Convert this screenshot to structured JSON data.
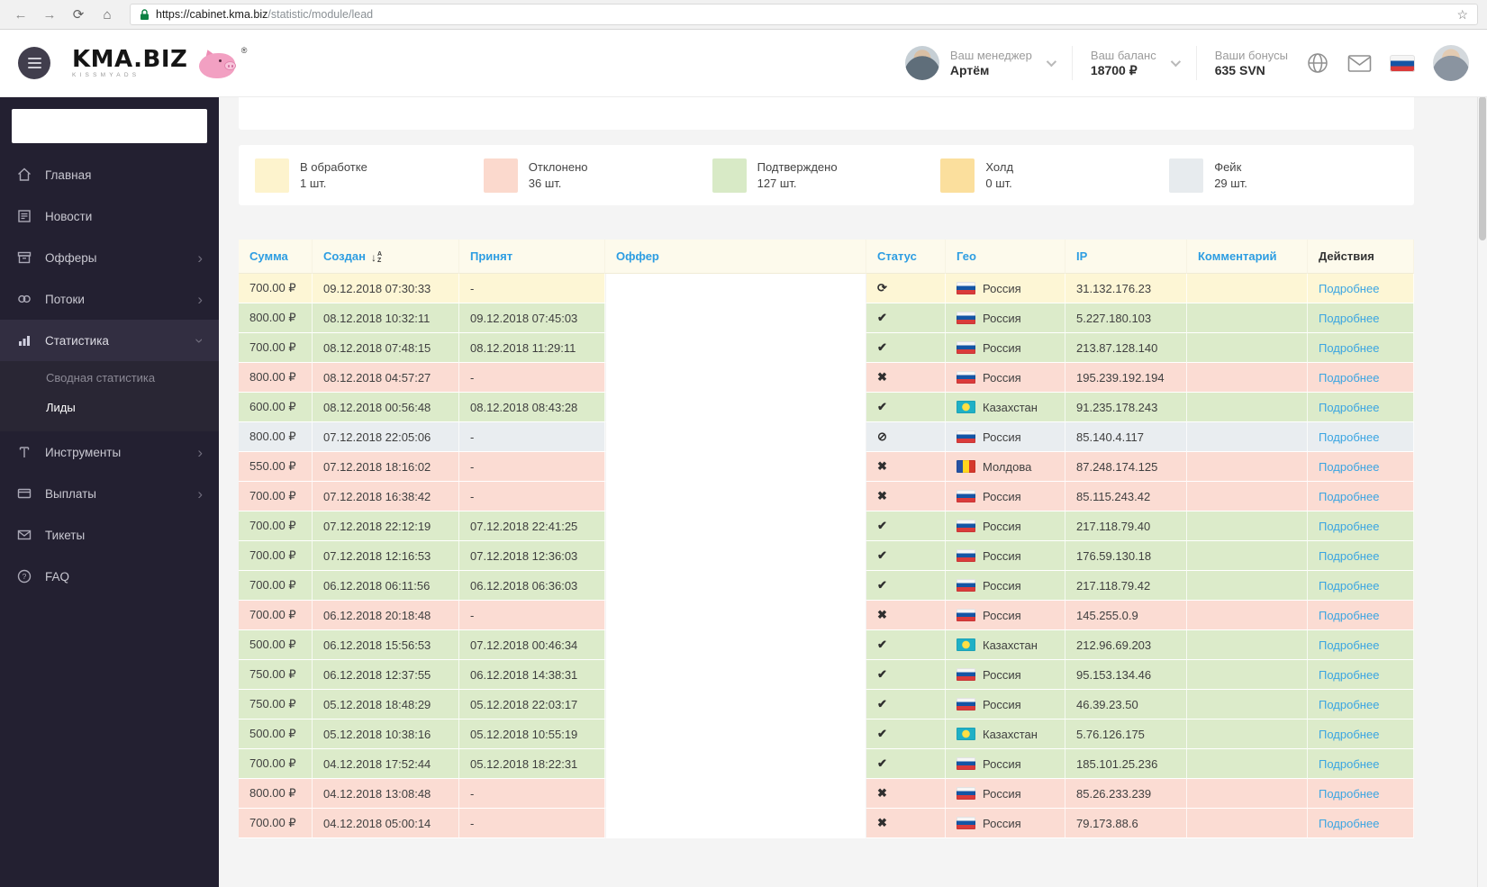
{
  "browser": {
    "url_host": "https://cabinet.kma.biz",
    "url_path": "/statistic/module/lead"
  },
  "header": {
    "logo_text": "KMA.BIZ",
    "logo_sub": "KISSMYADS",
    "reg_mark": "®",
    "manager_label": "Ваш менеджер",
    "manager_name": "Артём",
    "balance_label": "Ваш баланс",
    "balance_value": "18700 ₽",
    "bonus_label": "Ваши бонусы",
    "bonus_value": "635 SVN"
  },
  "sidebar": {
    "search_value": "",
    "items": [
      {
        "label": "Главная",
        "icon": "home-icon"
      },
      {
        "label": "Новости",
        "icon": "news-icon"
      },
      {
        "label": "Офферы",
        "icon": "offers-icon",
        "chevron": "right"
      },
      {
        "label": "Потоки",
        "icon": "streams-icon",
        "chevron": "right"
      },
      {
        "label": "Статистика",
        "icon": "stats-icon",
        "chevron": "down",
        "active": true,
        "submenu": [
          {
            "label": "Сводная статистика",
            "active": false
          },
          {
            "label": "Лиды",
            "active": true
          }
        ]
      },
      {
        "label": "Инструменты",
        "icon": "tools-icon",
        "chevron": "right"
      },
      {
        "label": "Выплаты",
        "icon": "payments-icon",
        "chevron": "right"
      },
      {
        "label": "Тикеты",
        "icon": "tickets-icon"
      },
      {
        "label": "FAQ",
        "icon": "faq-icon"
      }
    ]
  },
  "legend": [
    {
      "label": "В обработке",
      "count": "1 шт.",
      "color": "#fdf3cd"
    },
    {
      "label": "Отклонено",
      "count": "36 шт.",
      "color": "#fbd9cd"
    },
    {
      "label": "Подтверждено",
      "count": "127 шт.",
      "color": "#d8eac6"
    },
    {
      "label": "Холд",
      "count": "0 шт.",
      "color": "#fbdf9d"
    },
    {
      "label": "Фейк",
      "count": "29 шт.",
      "color": "#e7ebee"
    }
  ],
  "table": {
    "headers": [
      {
        "label": "Сумма",
        "link": true
      },
      {
        "label": "Создан",
        "link": true,
        "sort_icon": true
      },
      {
        "label": "Принят",
        "link": true
      },
      {
        "label": "Оффер",
        "link": true
      },
      {
        "label": "Статус",
        "link": true
      },
      {
        "label": "Гео",
        "link": true
      },
      {
        "label": "IP",
        "link": true
      },
      {
        "label": "Комментарий",
        "link": true
      },
      {
        "label": "Действия",
        "link": false
      }
    ],
    "action_label": "Подробнее",
    "rows": [
      {
        "sum": "700.00 ₽",
        "created": "09.12.2018 07:30:33",
        "accepted": "-",
        "status": "processing",
        "country": "Россия",
        "flag": "ru",
        "ip": "31.132.176.23",
        "comment": ""
      },
      {
        "sum": "800.00 ₽",
        "created": "08.12.2018 10:32:11",
        "accepted": "09.12.2018 07:45:03",
        "status": "approved",
        "country": "Россия",
        "flag": "ru",
        "ip": "5.227.180.103",
        "comment": ""
      },
      {
        "sum": "700.00 ₽",
        "created": "08.12.2018 07:48:15",
        "accepted": "08.12.2018 11:29:11",
        "status": "approved",
        "country": "Россия",
        "flag": "ru",
        "ip": "213.87.128.140",
        "comment": ""
      },
      {
        "sum": "800.00 ₽",
        "created": "08.12.2018 04:57:27",
        "accepted": "-",
        "status": "rejected",
        "country": "Россия",
        "flag": "ru",
        "ip": "195.239.192.194",
        "comment": ""
      },
      {
        "sum": "600.00 ₽",
        "created": "08.12.2018 00:56:48",
        "accepted": "08.12.2018 08:43:28",
        "status": "approved",
        "country": "Казахстан",
        "flag": "kz",
        "ip": "91.235.178.243",
        "comment": ""
      },
      {
        "sum": "800.00 ₽",
        "created": "07.12.2018 22:05:06",
        "accepted": "-",
        "status": "fake",
        "country": "Россия",
        "flag": "ru",
        "ip": "85.140.4.117",
        "comment": ""
      },
      {
        "sum": "550.00 ₽",
        "created": "07.12.2018 18:16:02",
        "accepted": "-",
        "status": "rejected",
        "country": "Молдова",
        "flag": "md",
        "ip": "87.248.174.125",
        "comment": ""
      },
      {
        "sum": "700.00 ₽",
        "created": "07.12.2018 16:38:42",
        "accepted": "-",
        "status": "rejected",
        "country": "Россия",
        "flag": "ru",
        "ip": "85.115.243.42",
        "comment": ""
      },
      {
        "sum": "700.00 ₽",
        "created": "07.12.2018 22:12:19",
        "accepted": "07.12.2018 22:41:25",
        "status": "approved",
        "country": "Россия",
        "flag": "ru",
        "ip": "217.118.79.40",
        "comment": ""
      },
      {
        "sum": "700.00 ₽",
        "created": "07.12.2018 12:16:53",
        "accepted": "07.12.2018 12:36:03",
        "status": "approved",
        "country": "Россия",
        "flag": "ru",
        "ip": "176.59.130.18",
        "comment": ""
      },
      {
        "sum": "700.00 ₽",
        "created": "06.12.2018 06:11:56",
        "accepted": "06.12.2018 06:36:03",
        "status": "approved",
        "country": "Россия",
        "flag": "ru",
        "ip": "217.118.79.42",
        "comment": ""
      },
      {
        "sum": "700.00 ₽",
        "created": "06.12.2018 20:18:48",
        "accepted": "-",
        "status": "rejected",
        "country": "Россия",
        "flag": "ru",
        "ip": "145.255.0.9",
        "comment": ""
      },
      {
        "sum": "500.00 ₽",
        "created": "06.12.2018 15:56:53",
        "accepted": "07.12.2018 00:46:34",
        "status": "approved",
        "country": "Казахстан",
        "flag": "kz",
        "ip": "212.96.69.203",
        "comment": ""
      },
      {
        "sum": "750.00 ₽",
        "created": "06.12.2018 12:37:55",
        "accepted": "06.12.2018 14:38:31",
        "status": "approved",
        "country": "Россия",
        "flag": "ru",
        "ip": "95.153.134.46",
        "comment": ""
      },
      {
        "sum": "750.00 ₽",
        "created": "05.12.2018 18:48:29",
        "accepted": "05.12.2018 22:03:17",
        "status": "approved",
        "country": "Россия",
        "flag": "ru",
        "ip": "46.39.23.50",
        "comment": ""
      },
      {
        "sum": "500.00 ₽",
        "created": "05.12.2018 10:38:16",
        "accepted": "05.12.2018 10:55:19",
        "status": "approved",
        "country": "Казахстан",
        "flag": "kz",
        "ip": "5.76.126.175",
        "comment": ""
      },
      {
        "sum": "700.00 ₽",
        "created": "04.12.2018 17:52:44",
        "accepted": "05.12.2018 18:22:31",
        "status": "approved",
        "country": "Россия",
        "flag": "ru",
        "ip": "185.101.25.236",
        "comment": ""
      },
      {
        "sum": "800.00 ₽",
        "created": "04.12.2018 13:08:48",
        "accepted": "-",
        "status": "rejected",
        "country": "Россия",
        "flag": "ru",
        "ip": "85.26.233.239",
        "comment": ""
      },
      {
        "sum": "700.00 ₽",
        "created": "04.12.2018 05:00:14",
        "accepted": "-",
        "status": "rejected",
        "country": "Россия",
        "flag": "ru",
        "ip": "79.173.88.6",
        "comment": ""
      }
    ]
  }
}
